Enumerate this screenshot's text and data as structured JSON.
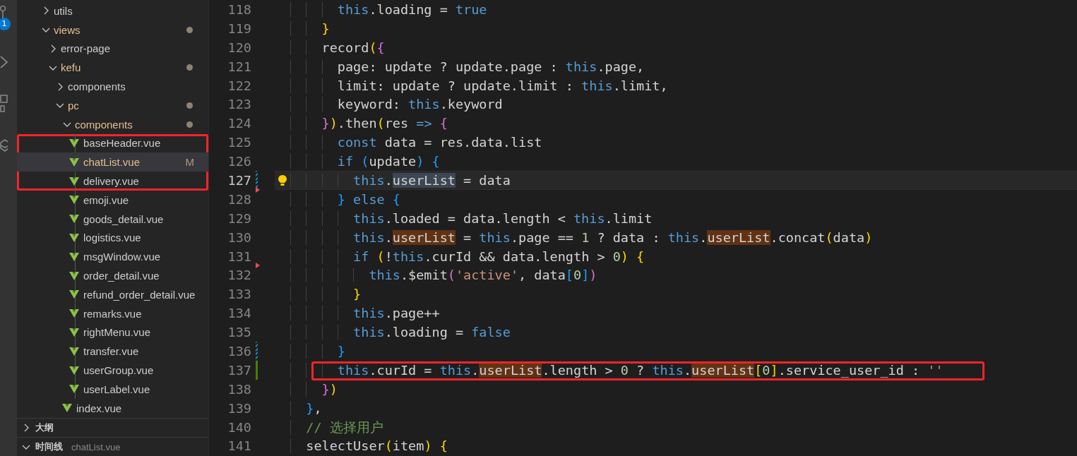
{
  "activity_bar": {
    "badge": "1"
  },
  "explorer": {
    "items": [
      {
        "label": "utils",
        "kind": "folder",
        "expanded": false,
        "modified": false,
        "selected": false
      },
      {
        "label": "views",
        "kind": "folder",
        "expanded": true,
        "modified": true,
        "selected": false,
        "children": [
          {
            "label": "error-page",
            "kind": "folder",
            "expanded": false,
            "modified": false,
            "selected": false
          },
          {
            "label": "kefu",
            "kind": "folder",
            "expanded": true,
            "modified": true,
            "selected": false,
            "children": [
              {
                "label": "components",
                "kind": "folder",
                "expanded": false,
                "modified": false,
                "selected": false
              },
              {
                "label": "pc",
                "kind": "folder",
                "expanded": true,
                "modified": true,
                "selected": false,
                "children": [
                  {
                    "label": "components",
                    "kind": "folder",
                    "expanded": true,
                    "modified": true,
                    "selected": false,
                    "children": [
                      {
                        "label": "baseHeader.vue",
                        "kind": "vue",
                        "modified": false,
                        "selected": false,
                        "marked": true
                      },
                      {
                        "label": "chatList.vue",
                        "kind": "vue",
                        "modified": true,
                        "badge": "M",
                        "selected": true,
                        "marked": true
                      },
                      {
                        "label": "delivery.vue",
                        "kind": "vue",
                        "modified": false,
                        "selected": false,
                        "marked": true
                      },
                      {
                        "label": "emoji.vue",
                        "kind": "vue",
                        "modified": false,
                        "selected": false,
                        "marked": false
                      },
                      {
                        "label": "goods_detail.vue",
                        "kind": "vue",
                        "modified": false,
                        "selected": false,
                        "marked": false
                      },
                      {
                        "label": "logistics.vue",
                        "kind": "vue",
                        "modified": false,
                        "selected": false,
                        "marked": false
                      },
                      {
                        "label": "msgWindow.vue",
                        "kind": "vue",
                        "modified": false,
                        "selected": false,
                        "marked": false
                      },
                      {
                        "label": "order_detail.vue",
                        "kind": "vue",
                        "modified": false,
                        "selected": false,
                        "marked": false
                      },
                      {
                        "label": "refund_order_detail.vue",
                        "kind": "vue",
                        "modified": false,
                        "selected": false,
                        "marked": false
                      },
                      {
                        "label": "remarks.vue",
                        "kind": "vue",
                        "modified": false,
                        "selected": false,
                        "marked": false
                      },
                      {
                        "label": "rightMenu.vue",
                        "kind": "vue",
                        "modified": false,
                        "selected": false,
                        "marked": false
                      },
                      {
                        "label": "transfer.vue",
                        "kind": "vue",
                        "modified": false,
                        "selected": false,
                        "marked": false
                      },
                      {
                        "label": "userGroup.vue",
                        "kind": "vue",
                        "modified": false,
                        "selected": false,
                        "marked": false
                      },
                      {
                        "label": "userLabel.vue",
                        "kind": "vue",
                        "modified": false,
                        "selected": false,
                        "marked": false
                      }
                    ]
                  },
                  {
                    "label": "index.vue",
                    "kind": "vue",
                    "modified": false,
                    "selected": false
                  }
                ]
              }
            ]
          }
        ]
      }
    ]
  },
  "panels": [
    {
      "title": "大纲",
      "expanded": false
    },
    {
      "title": "时间线",
      "expanded": true,
      "subtitle": "chatList.vue"
    }
  ],
  "editor": {
    "lines": [
      {
        "number": "118",
        "tokens": [
          {
            "text": "      this",
            "kind": "kw"
          },
          {
            "text": ".loading = ",
            "kind": "plain"
          },
          {
            "text": "true",
            "kind": "kw"
          }
        ]
      },
      {
        "number": "119",
        "tokens": [
          {
            "text": "    }",
            "kind": "b1"
          }
        ]
      },
      {
        "number": "120",
        "tokens": [
          {
            "text": "    record",
            "kind": "plain"
          },
          {
            "text": "(",
            "kind": "b1"
          },
          {
            "text": "{",
            "kind": "b2"
          }
        ]
      },
      {
        "number": "121",
        "tokens": [
          {
            "text": "      page: update ? update.page : ",
            "kind": "plain"
          },
          {
            "text": "this",
            "kind": "kw"
          },
          {
            "text": ".page,",
            "kind": "plain"
          }
        ]
      },
      {
        "number": "122",
        "tokens": [
          {
            "text": "      limit: update ? update.limit : ",
            "kind": "plain"
          },
          {
            "text": "this",
            "kind": "kw"
          },
          {
            "text": ".limit,",
            "kind": "plain"
          }
        ]
      },
      {
        "number": "123",
        "tokens": [
          {
            "text": "      keyword: ",
            "kind": "plain"
          },
          {
            "text": "this",
            "kind": "kw"
          },
          {
            "text": ".keyword",
            "kind": "plain"
          }
        ]
      },
      {
        "number": "124",
        "tokens": [
          {
            "text": "    }",
            "kind": "b2"
          },
          {
            "text": ")",
            "kind": "b1"
          },
          {
            "text": ".then",
            "kind": "plain"
          },
          {
            "text": "(",
            "kind": "b1"
          },
          {
            "text": "res ",
            "kind": "plain"
          },
          {
            "text": "=>",
            "kind": "kw"
          },
          {
            "text": " {",
            "kind": "b2"
          }
        ]
      },
      {
        "number": "125",
        "tokens": [
          {
            "text": "      const",
            "kind": "kw"
          },
          {
            "text": " data = res.data.list",
            "kind": "plain"
          }
        ]
      },
      {
        "number": "126",
        "tokens": [
          {
            "text": "      if",
            "kind": "kw"
          },
          {
            "text": " (",
            "kind": "b3"
          },
          {
            "text": "update",
            "kind": "plain"
          },
          {
            "text": ")",
            "kind": "b3"
          },
          {
            "text": " {",
            "kind": "b3"
          }
        ]
      },
      {
        "number": "127",
        "current": true,
        "lightbulb": true,
        "git_modified": true,
        "tokens": [
          {
            "text": "        this",
            "kind": "kw"
          },
          {
            "text": ".",
            "kind": "plain"
          },
          {
            "text": "userList",
            "kind": "sel"
          },
          {
            "text": " = data",
            "kind": "plain"
          }
        ]
      },
      {
        "number": "128",
        "git_deleted": true,
        "tokens": [
          {
            "text": "      }",
            "kind": "b3"
          },
          {
            "text": " else",
            "kind": "kw"
          },
          {
            "text": " {",
            "kind": "b3"
          }
        ]
      },
      {
        "number": "129",
        "tokens": [
          {
            "text": "        this",
            "kind": "kw"
          },
          {
            "text": ".loaded = data.length < ",
            "kind": "plain"
          },
          {
            "text": "this",
            "kind": "kw"
          },
          {
            "text": ".limit",
            "kind": "plain"
          }
        ]
      },
      {
        "number": "130",
        "tokens": [
          {
            "text": "        this",
            "kind": "kw"
          },
          {
            "text": ".",
            "kind": "plain"
          },
          {
            "text": "userList",
            "kind": "fm"
          },
          {
            "text": " = ",
            "kind": "plain"
          },
          {
            "text": "this",
            "kind": "kw"
          },
          {
            "text": ".page == ",
            "kind": "plain"
          },
          {
            "text": "1",
            "kind": "num"
          },
          {
            "text": " ? data : ",
            "kind": "plain"
          },
          {
            "text": "this",
            "kind": "kw"
          },
          {
            "text": ".",
            "kind": "plain"
          },
          {
            "text": "userList",
            "kind": "fm"
          },
          {
            "text": ".concat",
            "kind": "plain"
          },
          {
            "text": "(",
            "kind": "b1"
          },
          {
            "text": "data",
            "kind": "plain"
          },
          {
            "text": ")",
            "kind": "b1"
          }
        ]
      },
      {
        "number": "131",
        "tokens": [
          {
            "text": "        if",
            "kind": "kw"
          },
          {
            "text": " (",
            "kind": "b1"
          },
          {
            "text": "!",
            "kind": "plain"
          },
          {
            "text": "this",
            "kind": "kw"
          },
          {
            "text": ".curId && data.length > ",
            "kind": "plain"
          },
          {
            "text": "0",
            "kind": "num"
          },
          {
            "text": ")",
            "kind": "b1"
          },
          {
            "text": " {",
            "kind": "b1"
          }
        ]
      },
      {
        "number": "132",
        "git_deleted": true,
        "tokens": [
          {
            "text": "          this",
            "kind": "kw"
          },
          {
            "text": ".$emit",
            "kind": "plain"
          },
          {
            "text": "(",
            "kind": "b2"
          },
          {
            "text": "'active'",
            "kind": "str"
          },
          {
            "text": ", data",
            "kind": "plain"
          },
          {
            "text": "[",
            "kind": "b3"
          },
          {
            "text": "0",
            "kind": "num"
          },
          {
            "text": "]",
            "kind": "b3"
          },
          {
            "text": ")",
            "kind": "b2"
          }
        ]
      },
      {
        "number": "133",
        "tokens": [
          {
            "text": "        }",
            "kind": "b1"
          }
        ]
      },
      {
        "number": "134",
        "tokens": [
          {
            "text": "        this",
            "kind": "kw"
          },
          {
            "text": ".page++",
            "kind": "plain"
          }
        ]
      },
      {
        "number": "135",
        "tokens": [
          {
            "text": "        this",
            "kind": "kw"
          },
          {
            "text": ".loading = ",
            "kind": "plain"
          },
          {
            "text": "false",
            "kind": "kw"
          }
        ]
      },
      {
        "number": "136",
        "git_modified": true,
        "tokens": [
          {
            "text": "      }",
            "kind": "b3"
          }
        ]
      },
      {
        "number": "137",
        "git_added": true,
        "marked": true,
        "tokens": [
          {
            "text": "      this",
            "kind": "kw"
          },
          {
            "text": ".curId = ",
            "kind": "plain"
          },
          {
            "text": "this",
            "kind": "kw"
          },
          {
            "text": ".",
            "kind": "plain"
          },
          {
            "text": "userList",
            "kind": "fm"
          },
          {
            "text": ".length > ",
            "kind": "plain"
          },
          {
            "text": "0",
            "kind": "num"
          },
          {
            "text": " ? ",
            "kind": "plain"
          },
          {
            "text": "this",
            "kind": "kw"
          },
          {
            "text": ".",
            "kind": "plain"
          },
          {
            "text": "userList",
            "kind": "fm"
          },
          {
            "text": "[",
            "kind": "b1"
          },
          {
            "text": "0",
            "kind": "num"
          },
          {
            "text": "]",
            "kind": "b1"
          },
          {
            "text": ".service_user_id : ",
            "kind": "plain"
          },
          {
            "text": "''",
            "kind": "str"
          }
        ]
      },
      {
        "number": "138",
        "tokens": [
          {
            "text": "    }",
            "kind": "b2"
          },
          {
            "text": ")",
            "kind": "b1"
          }
        ]
      },
      {
        "number": "139",
        "tokens": [
          {
            "text": "  }",
            "kind": "b3"
          },
          {
            "text": ",",
            "kind": "plain"
          }
        ]
      },
      {
        "number": "140",
        "tokens": [
          {
            "text": "  // 选择用户",
            "kind": "cm"
          }
        ]
      },
      {
        "number": "141",
        "tokens": [
          {
            "text": "  selectUser",
            "kind": "plain"
          },
          {
            "text": "(",
            "kind": "b1"
          },
          {
            "text": "item",
            "kind": "plain"
          },
          {
            "text": ")",
            "kind": "b1"
          },
          {
            "text": " {",
            "kind": "b1"
          }
        ]
      }
    ]
  }
}
